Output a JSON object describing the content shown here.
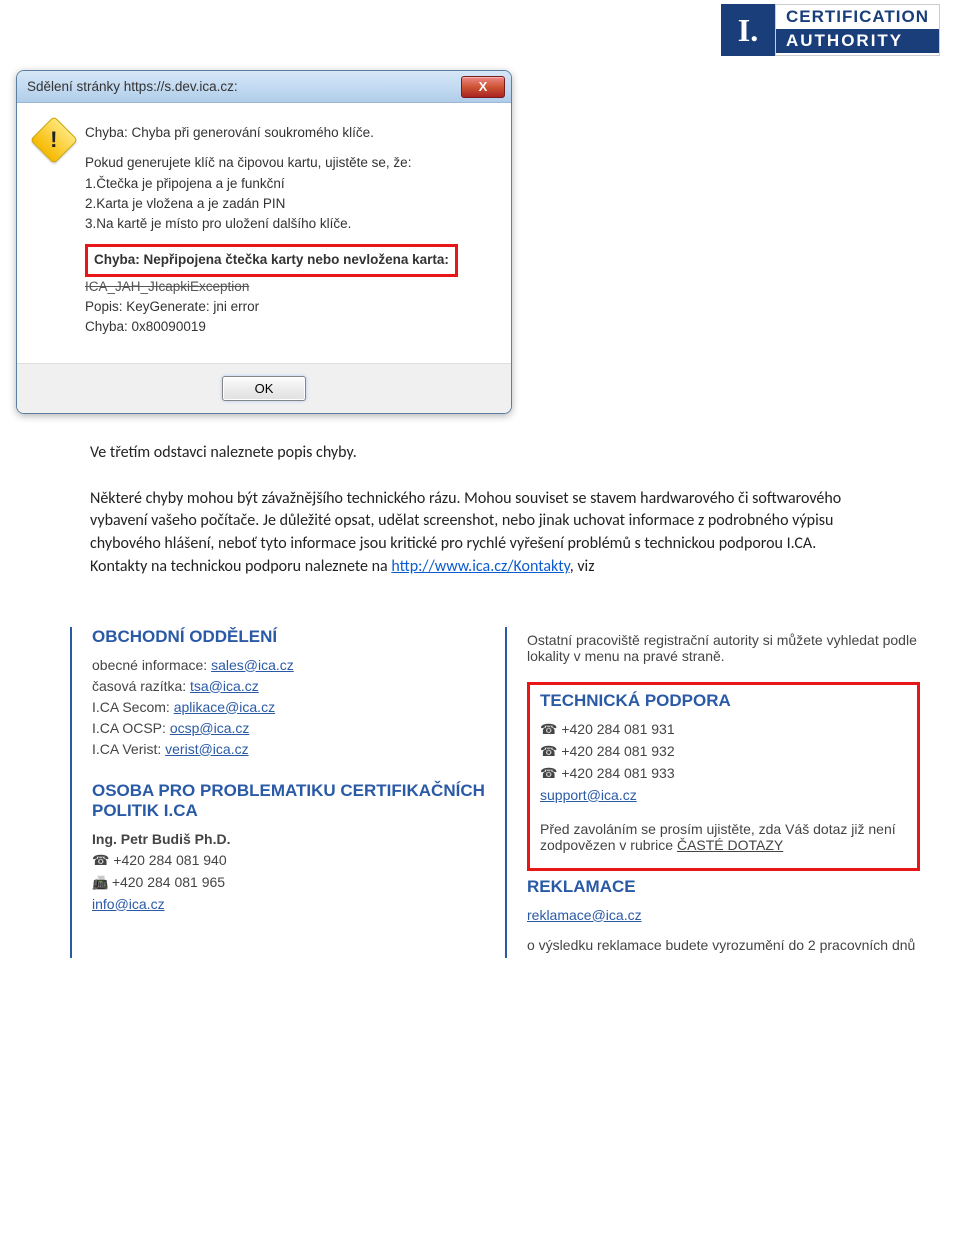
{
  "logo": {
    "mark": "I.",
    "line1": "CERTIFICATION",
    "line2": "AUTHORITY"
  },
  "dialog": {
    "title": "Sdělení stránky https://s.dev.ica.cz:",
    "close_symbol": "X",
    "warning_mark": "!",
    "error_heading": "Chyba: Chyba při generování soukromého klíče.",
    "card_intro": "Pokud generujete klíč na čipovou kartu, ujistěte se, že:",
    "card_step1": "1.Čtečka je připojena a je funkční",
    "card_step2": "2.Karta je vložena a je zadán PIN",
    "card_step3": "3.Na kartě je místo pro uložení dalšího klíče.",
    "highlight": "Chyba: Nepřipojena čtečka karty nebo nevložena karta:",
    "exception_line": "ICA_JAH_JIcapkiException",
    "popis": "Popis: KeyGenerate: jni error",
    "error_code": "Chyba: 0x80090019",
    "ok": "OK"
  },
  "doc": {
    "p1_a": "Ve třetím odstavci naleznete popis chyby.",
    "p2_a": "Některé chyby mohou být závažnějšího technického rázu. Mohou souviset se stavem hardwarového či softwarového vybavení vašeho počítače. Je důležité opsat, udělat screenshot, nebo jinak uchovat informace z podrobného výpisu chybového hlášení, neboť tyto informace jsou kritické pro rychlé vyřešení problémů s technickou podporou I.CA. Kontakty na technickou podporu naleznete na ",
    "p2_link": "http://www.ica.cz/Kontakty",
    "p2_b": ", viz"
  },
  "contacts": {
    "left": {
      "obchodni_title": "OBCHODNÍ ODDĚLENÍ",
      "obecne_label": "obecné informace: ",
      "obecne_mail": "sales@ica.cz",
      "razitka_label": "časová razítka: ",
      "razitka_mail": "tsa@ica.cz",
      "secom_label": "I.CA Secom: ",
      "secom_mail": "aplikace@ica.cz",
      "ocsp_label": "I.CA OCSP: ",
      "ocsp_mail": "ocsp@ica.cz",
      "verist_label": "I.CA Verist: ",
      "verist_mail": "verist@ica.cz",
      "osoba_title": "OSOBA PRO PROBLEMATIKU CERTIFIKAČNÍCH POLITIK I.CA",
      "osoba_name": "Ing. Petr Budiš Ph.D.",
      "osoba_phone": "+420 284 081 940",
      "osoba_fax": "+420 284 081 965",
      "info_mail": "info@ica.cz"
    },
    "right": {
      "ostatni": "Ostatní pracoviště registrační autority si můžete vyhledat podle lokality v menu na pravé straně.",
      "tech_title": "TECHNICKÁ PODPORA",
      "tech_phone1": "+420 284 081 931",
      "tech_phone2": "+420 284 081 932",
      "tech_phone3": "+420 284 081 933",
      "support_mail": "support@ica.cz",
      "tech_note_a": "Před zavoláním se prosím ujistěte, zda Váš dotaz již není zodpovězen v rubrice ",
      "tech_note_link": "ČASTÉ DOTAZY",
      "reklamace_title": "REKLAMACE",
      "reklamace_mail": "reklamace@ica.cz",
      "reklamace_note": "o výsledku reklamace budete vyrozumění do 2 pracovních dnů"
    }
  }
}
